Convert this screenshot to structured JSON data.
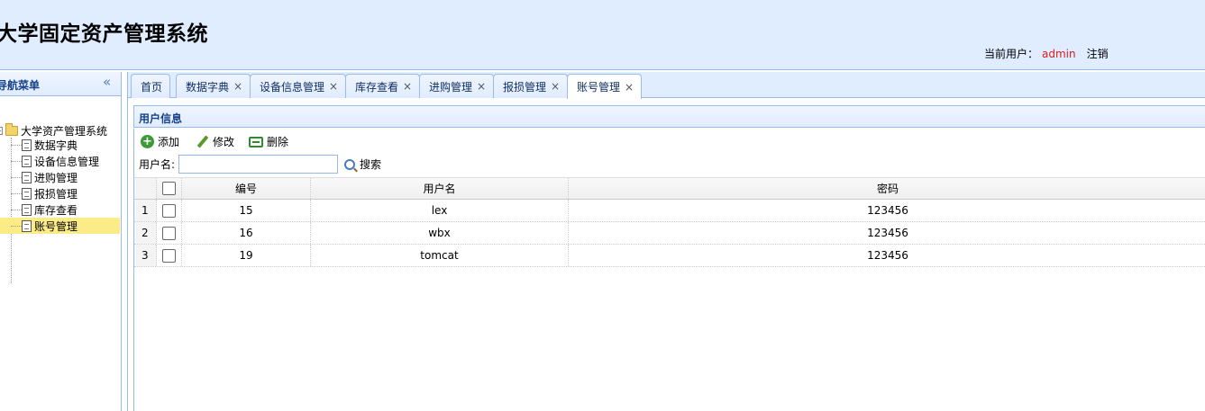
{
  "header": {
    "title": "大学固定资产管理系统",
    "current_user_label": "当前用户：",
    "username": "admin",
    "logout": "注销"
  },
  "sidebar": {
    "title": "导航菜单",
    "collapse_icon": "double-chevron-left-icon",
    "root": "大学资产管理系统",
    "items": [
      {
        "label": "数据字典"
      },
      {
        "label": "设备信息管理"
      },
      {
        "label": "进购管理"
      },
      {
        "label": "报损管理"
      },
      {
        "label": "库存查看"
      },
      {
        "label": "账号管理",
        "selected": true
      }
    ]
  },
  "tabs": [
    {
      "label": "首页",
      "closable": false
    },
    {
      "label": "数据字典",
      "closable": true
    },
    {
      "label": "设备信息管理",
      "closable": true
    },
    {
      "label": "库存查看",
      "closable": true
    },
    {
      "label": "进购管理",
      "closable": true
    },
    {
      "label": "报损管理",
      "closable": true
    },
    {
      "label": "账号管理",
      "closable": true,
      "active": true
    }
  ],
  "tab_close_glyph": "×",
  "panel": {
    "title": "用户信息"
  },
  "toolbar": {
    "add": "添加",
    "edit": "修改",
    "delete": "删除"
  },
  "search": {
    "label": "用户名:",
    "value": "",
    "placeholder": "",
    "button": "搜索"
  },
  "grid": {
    "columns": [
      "编号",
      "用户名",
      "密码"
    ],
    "rows": [
      {
        "num": "1",
        "id": "15",
        "username": "lex",
        "password": "123456"
      },
      {
        "num": "2",
        "id": "16",
        "username": "wbx",
        "password": "123456"
      },
      {
        "num": "3",
        "id": "19",
        "username": "tomcat",
        "password": "123456"
      }
    ]
  },
  "colors": {
    "header_bg": "#e0ecff",
    "border": "#99bbe8",
    "username": "#e01b1b",
    "selected_item": "#fbec88"
  }
}
